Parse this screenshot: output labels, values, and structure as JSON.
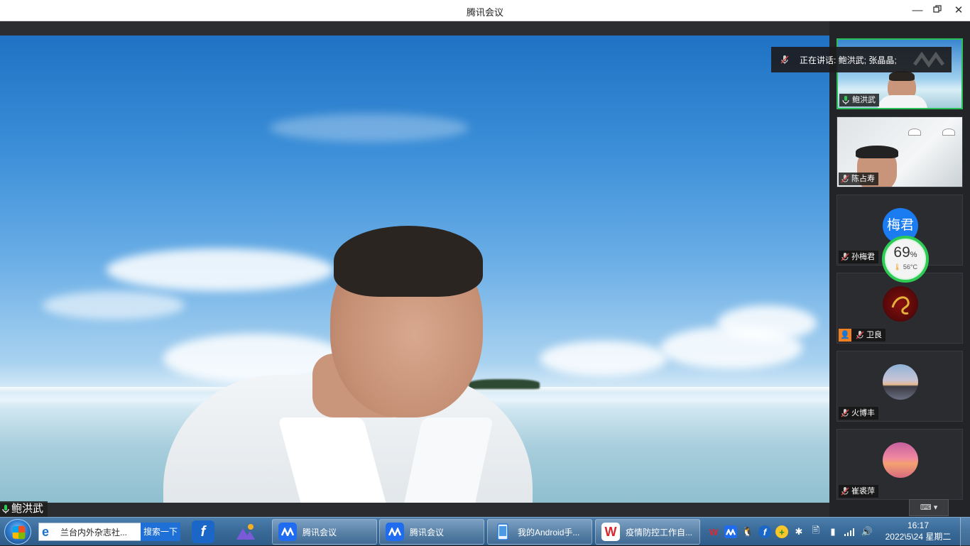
{
  "window": {
    "title": "腾讯会议"
  },
  "speaking_banner": {
    "text": "正在讲话: 鲍洪武; 张晶晶;"
  },
  "main_speaker": {
    "name": "鲍洪武"
  },
  "participants": [
    {
      "name": "鲍洪武",
      "mic": "on",
      "active": true
    },
    {
      "name": "陈占寿",
      "mic": "muted"
    },
    {
      "name": "孙梅君",
      "mic": "muted",
      "avatar_text": "梅君"
    },
    {
      "name": "卫良",
      "mic": "muted"
    },
    {
      "name": "火博丰",
      "mic": "muted"
    },
    {
      "name": "崔裘萍",
      "mic": "muted"
    }
  ],
  "perf_widget": {
    "percent": "69",
    "unit": "%",
    "temp": "56°C"
  },
  "taskbar": {
    "search_text": "兰台内外杂志社...",
    "search_button": "搜索一下",
    "buttons": [
      {
        "label": "腾讯会议"
      },
      {
        "label": "腾讯会议"
      },
      {
        "label": "我的Android手..."
      },
      {
        "label": "疫情防控工作自..."
      }
    ],
    "clock_time": "16:17",
    "clock_date": "2022\\5\\24 星期二"
  },
  "colors": {
    "active_border": "#2bbf5a",
    "avatar_blue": "#1a7cf0",
    "taskbar": "#3a6b99"
  }
}
